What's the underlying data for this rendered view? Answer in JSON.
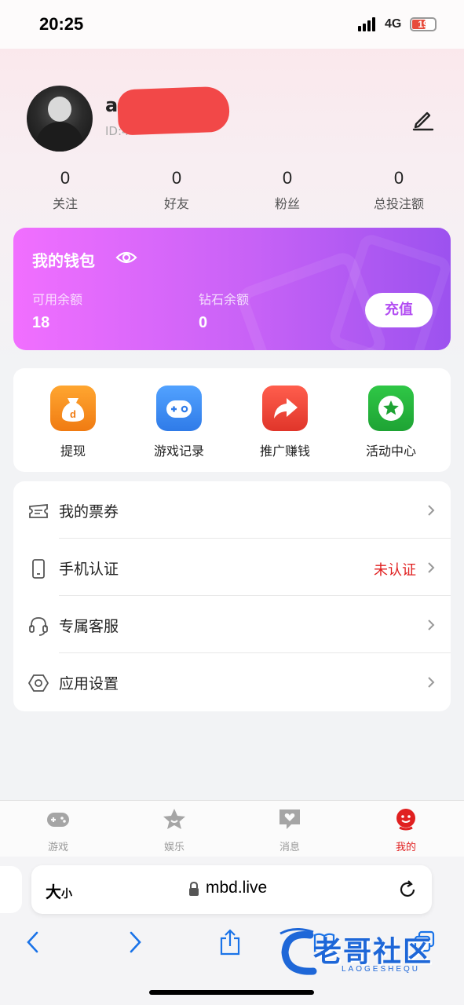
{
  "status_bar": {
    "time": "20:25",
    "network": "4G",
    "battery": "19"
  },
  "profile": {
    "name_visible": "a",
    "id_visible": "ID:4"
  },
  "stats": [
    {
      "value": "0",
      "label": "关注"
    },
    {
      "value": "0",
      "label": "好友"
    },
    {
      "value": "0",
      "label": "粉丝"
    },
    {
      "value": "0",
      "label": "总投注额"
    }
  ],
  "wallet": {
    "title": "我的钱包",
    "available_label": "可用余额",
    "available_value": "18",
    "diamond_label": "钻石余额",
    "diamond_value": "0",
    "recharge_label": "充值"
  },
  "actions": [
    {
      "label": "提现",
      "icon": "money-bag-icon",
      "color": "#f5901f"
    },
    {
      "label": "游戏记录",
      "icon": "gamepad-icon",
      "color": "#3d8cf5"
    },
    {
      "label": "推广赚钱",
      "icon": "share-arrow-icon",
      "color": "#f0463a"
    },
    {
      "label": "活动中心",
      "icon": "star-icon",
      "color": "#26b23b"
    }
  ],
  "menu": [
    {
      "label": "我的票券",
      "icon": "ticket-icon",
      "status": ""
    },
    {
      "label": "手机认证",
      "icon": "phone-icon",
      "status": "未认证"
    },
    {
      "label": "专属客服",
      "icon": "headset-icon",
      "status": ""
    },
    {
      "label": "应用设置",
      "icon": "settings-icon",
      "status": ""
    }
  ],
  "tabbar": [
    {
      "label": "游戏",
      "icon": "gamepad-icon",
      "active": false
    },
    {
      "label": "娱乐",
      "icon": "star-icon",
      "active": false
    },
    {
      "label": "消息",
      "icon": "message-icon",
      "active": false
    },
    {
      "label": "我的",
      "icon": "profile-icon",
      "active": true
    }
  ],
  "browser": {
    "text_size_large": "大",
    "text_size_small": "小",
    "url": "mbd.live"
  },
  "watermark": {
    "text": "老哥社区",
    "sub": "LAOGESHEQU"
  },
  "colors": {
    "accent_red": "#e02020",
    "wallet_start": "#f16fff",
    "wallet_end": "#9c52ef"
  }
}
